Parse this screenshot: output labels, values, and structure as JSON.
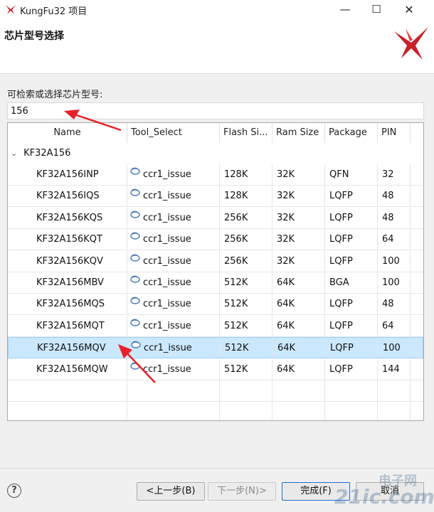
{
  "window": {
    "title": "KungFu32 项目",
    "min_glyph": "—",
    "max_glyph": "☐",
    "close_glyph": "✕"
  },
  "header": {
    "title": "芯片型号选择",
    "logo_icon": "kungfu-logo-icon"
  },
  "search": {
    "label": "可检索或选择芯片型号:",
    "value": "156"
  },
  "table": {
    "columns": [
      "Name",
      "Tool_Select",
      "Flash Si...",
      "Ram Size",
      "Package",
      "PIN"
    ],
    "group": {
      "label": "KF32A156",
      "expanded": true
    },
    "rows": [
      {
        "name": "KF32A156INP",
        "tool": "ccr1_issue",
        "flash": "128K",
        "ram": "32K",
        "package": "QFN",
        "pin": "32"
      },
      {
        "name": "KF32A156IQS",
        "tool": "ccr1_issue",
        "flash": "128K",
        "ram": "32K",
        "package": "LQFP",
        "pin": "48"
      },
      {
        "name": "KF32A156KQS",
        "tool": "ccr1_issue",
        "flash": "256K",
        "ram": "32K",
        "package": "LQFP",
        "pin": "48"
      },
      {
        "name": "KF32A156KQT",
        "tool": "ccr1_issue",
        "flash": "256K",
        "ram": "32K",
        "package": "LQFP",
        "pin": "64"
      },
      {
        "name": "KF32A156KQV",
        "tool": "ccr1_issue",
        "flash": "256K",
        "ram": "32K",
        "package": "LQFP",
        "pin": "100"
      },
      {
        "name": "KF32A156MBV",
        "tool": "ccr1_issue",
        "flash": "512K",
        "ram": "64K",
        "package": "BGA",
        "pin": "100"
      },
      {
        "name": "KF32A156MQS",
        "tool": "ccr1_issue",
        "flash": "512K",
        "ram": "64K",
        "package": "LQFP",
        "pin": "48"
      },
      {
        "name": "KF32A156MQT",
        "tool": "ccr1_issue",
        "flash": "512K",
        "ram": "64K",
        "package": "LQFP",
        "pin": "64"
      },
      {
        "name": "KF32A156MQV",
        "tool": "ccr1_issue",
        "flash": "512K",
        "ram": "64K",
        "package": "LQFP",
        "pin": "100",
        "selected": true
      },
      {
        "name": "KF32A156MQW",
        "tool": "ccr1_issue",
        "flash": "512K",
        "ram": "64K",
        "package": "LQFP",
        "pin": "144"
      }
    ]
  },
  "buttons": {
    "back": "<上一步(B)",
    "next": "下一步(N)>",
    "finish": "完成(F)",
    "cancel": "取消",
    "help": "?"
  },
  "watermark": {
    "line1": "电子网",
    "line2": "21ic.com"
  },
  "colors": {
    "selection": "#cce8ff",
    "selection_border": "#99d1ff",
    "arrow": "#e8202a",
    "finish_border": "#1e6fd0"
  }
}
